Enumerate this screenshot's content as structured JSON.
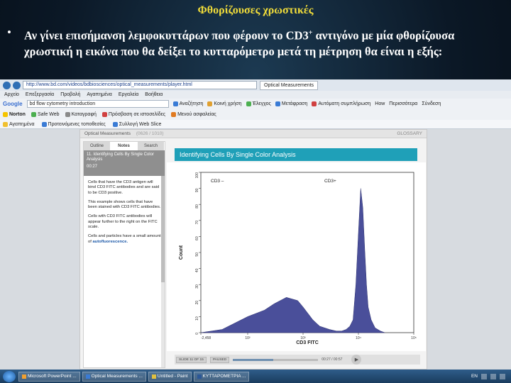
{
  "slide": {
    "title": "Φθορίζουσες χρωστικές",
    "bullet": "•",
    "text_part1": "Αν γίνει επισήμανση λεμφοκυττάρων που φέρουν το CD3",
    "text_sup": "+",
    "text_part2": " αντιγόνο με μία φθορίζουσα χρωστική η εικόνα που θα δείξει το κυτταρόμετρο μετά τη μέτρηση θα είναι η εξής:"
  },
  "browser": {
    "address": "http://www.bd.com/videos/bdbiosciences/optical_measurements/player.html",
    "tabs": [
      "Optical Measurements"
    ],
    "menu": [
      "Αρχείο",
      "Επεξεργασία",
      "Προβολή",
      "Αγαπημένα",
      "Εργαλεία",
      "Βοήθεια"
    ],
    "google": {
      "logo": "Google",
      "query": "bd flow cytometry introduction",
      "toolbar_items": [
        "Αναζήτηση",
        "Κοινή χρήση",
        "Έλεγχος",
        "Μετάφραση",
        "Αυτόματη συμπλήρωση",
        "How",
        "Περισσότερα",
        "Σύνδεση"
      ]
    },
    "norton": {
      "brand": "Norton",
      "items": [
        "Safe Web",
        "Καταγραφή",
        "Πρόσβαση σε ιστοσελίδες",
        "Μενού ασφαλείας"
      ]
    },
    "favorites": [
      "Αγαπημένα",
      "Προτεινόμενες τοποθεσίες",
      "Συλλογή Web Slice"
    ]
  },
  "player": {
    "header": "Optical Measurements",
    "page_count": "(0626 / 1010)",
    "glossary": "GLOSSARY",
    "tabs": [
      "Outline",
      "Notes",
      "Search"
    ],
    "lesson_title": "11. Identifying Cells By Single Color Analysis",
    "lesson_time": "00:27",
    "notes": [
      {
        "text": "Cells that have the CD3 antigen will bind CD3 FITC antibodies and are said to be CD3 positive."
      },
      {
        "text": "This example shows cells that have been stained with CD3 FITC antibodies."
      },
      {
        "text": "Cells with CD3 FITC antibodies will appear further to the right on the FITC scale."
      },
      {
        "text": "Cells and particles have a small amount of ",
        "highlight": "autofluorescence."
      }
    ],
    "banner": "Identifying Cells By Single Color Analysis",
    "controls": {
      "back": "SLIDE 11 OF 15",
      "state": "PAUSED",
      "time": "00:27 / 00:57",
      "progress": 0.47
    }
  },
  "chart_data": {
    "type": "area",
    "title": "",
    "xlabel": "CD3 FITC",
    "ylabel": "Count",
    "x_scale": "log",
    "x_tick_labels": [
      "-2,458",
      "10²",
      "10³",
      "10⁴",
      "10⁵"
    ],
    "y_ticks": [
      0,
      10,
      20,
      30,
      40,
      50,
      60,
      70,
      80,
      90,
      100
    ],
    "ylim": [
      0,
      100
    ],
    "region_labels": [
      "CD3 –",
      "CD3+"
    ],
    "series": [
      {
        "x": [
          -2458,
          0,
          100,
          200,
          300,
          500,
          800,
          1000,
          1500,
          2000,
          3000,
          4000,
          5000,
          6000,
          7000,
          8000,
          9000,
          10000,
          11000,
          12000,
          13000,
          14000,
          15000,
          17000,
          20000,
          25000,
          30000
        ],
        "values": [
          0,
          2,
          10,
          14,
          18,
          22,
          20,
          16,
          8,
          4,
          2,
          1,
          1,
          2,
          4,
          8,
          30,
          62,
          90,
          78,
          52,
          30,
          16,
          8,
          3,
          1,
          0
        ]
      }
    ],
    "fill_color": "#4a4f9a"
  },
  "taskbar": {
    "tasks": [
      "Microsoft PowerPoint ...",
      "Optical Measurements ...",
      "Untitled - Paint",
      "ΚΥΤΤΑΡΟΜΕΤΡΙΑ ..."
    ],
    "tray_lang": "EN"
  }
}
